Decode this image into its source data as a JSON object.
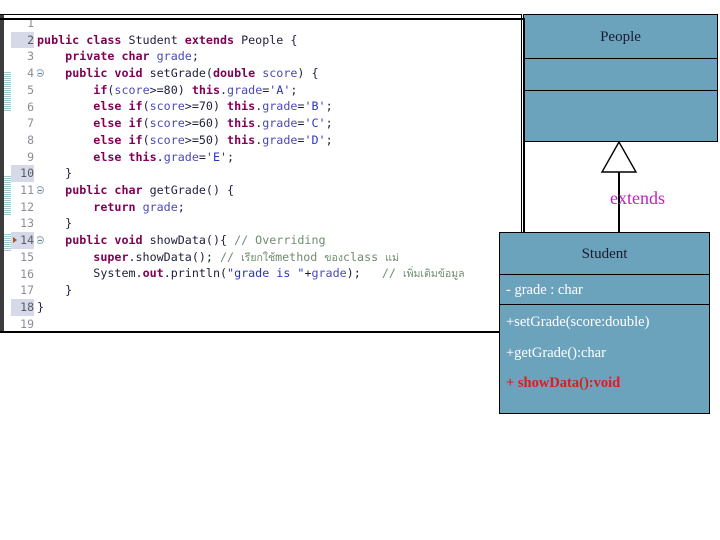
{
  "code_panel": {
    "name": "java-code-editor",
    "lines": [
      {
        "no": "1",
        "highlight": false,
        "fold": false,
        "override": false,
        "tokens": []
      },
      {
        "no": "2",
        "highlight": true,
        "fold": false,
        "override": false,
        "tokens": [
          {
            "t": "kw",
            "v": "public class "
          },
          {
            "t": "id",
            "v": "Student "
          },
          {
            "t": "kw",
            "v": "extends "
          },
          {
            "t": "id",
            "v": "People {"
          }
        ]
      },
      {
        "no": "3",
        "highlight": false,
        "fold": false,
        "override": false,
        "tokens": [
          {
            "t": "id",
            "v": "    "
          },
          {
            "t": "kw",
            "v": "private char "
          },
          {
            "t": "fld",
            "v": "grade"
          },
          {
            "t": "id",
            "v": ";"
          }
        ]
      },
      {
        "no": "4",
        "highlight": false,
        "fold": true,
        "override": false,
        "tokens": [
          {
            "t": "id",
            "v": "    "
          },
          {
            "t": "kw",
            "v": "public void "
          },
          {
            "t": "id",
            "v": "setGrade("
          },
          {
            "t": "kw",
            "v": "double "
          },
          {
            "t": "fld",
            "v": "score"
          },
          {
            "t": "id",
            "v": ") {"
          }
        ]
      },
      {
        "no": "5",
        "highlight": false,
        "fold": false,
        "override": false,
        "tokens": [
          {
            "t": "id",
            "v": "        "
          },
          {
            "t": "kw",
            "v": "if"
          },
          {
            "t": "id",
            "v": "("
          },
          {
            "t": "fld",
            "v": "score"
          },
          {
            "t": "id",
            "v": ">=80) "
          },
          {
            "t": "kw",
            "v": "this"
          },
          {
            "t": "id",
            "v": "."
          },
          {
            "t": "fld",
            "v": "grade"
          },
          {
            "t": "id",
            "v": "="
          },
          {
            "t": "str",
            "v": "'A'"
          },
          {
            "t": "id",
            "v": ";"
          }
        ]
      },
      {
        "no": "6",
        "highlight": false,
        "fold": false,
        "override": false,
        "tokens": [
          {
            "t": "id",
            "v": "        "
          },
          {
            "t": "kw",
            "v": "else if"
          },
          {
            "t": "id",
            "v": "("
          },
          {
            "t": "fld",
            "v": "score"
          },
          {
            "t": "id",
            "v": ">=70) "
          },
          {
            "t": "kw",
            "v": "this"
          },
          {
            "t": "id",
            "v": "."
          },
          {
            "t": "fld",
            "v": "grade"
          },
          {
            "t": "id",
            "v": "="
          },
          {
            "t": "str",
            "v": "'B'"
          },
          {
            "t": "id",
            "v": ";"
          }
        ]
      },
      {
        "no": "7",
        "highlight": false,
        "fold": false,
        "override": false,
        "tokens": [
          {
            "t": "id",
            "v": "        "
          },
          {
            "t": "kw",
            "v": "else if"
          },
          {
            "t": "id",
            "v": "("
          },
          {
            "t": "fld",
            "v": "score"
          },
          {
            "t": "id",
            "v": ">=60) "
          },
          {
            "t": "kw",
            "v": "this"
          },
          {
            "t": "id",
            "v": "."
          },
          {
            "t": "fld",
            "v": "grade"
          },
          {
            "t": "id",
            "v": "="
          },
          {
            "t": "str",
            "v": "'C'"
          },
          {
            "t": "id",
            "v": ";"
          }
        ]
      },
      {
        "no": "8",
        "highlight": false,
        "fold": false,
        "override": false,
        "tokens": [
          {
            "t": "id",
            "v": "        "
          },
          {
            "t": "kw",
            "v": "else if"
          },
          {
            "t": "id",
            "v": "("
          },
          {
            "t": "fld",
            "v": "score"
          },
          {
            "t": "id",
            "v": ">=50) "
          },
          {
            "t": "kw",
            "v": "this"
          },
          {
            "t": "id",
            "v": "."
          },
          {
            "t": "fld",
            "v": "grade"
          },
          {
            "t": "id",
            "v": "="
          },
          {
            "t": "str",
            "v": "'D'"
          },
          {
            "t": "id",
            "v": ";"
          }
        ]
      },
      {
        "no": "9",
        "highlight": false,
        "fold": false,
        "override": false,
        "tokens": [
          {
            "t": "id",
            "v": "        "
          },
          {
            "t": "kw",
            "v": "else this"
          },
          {
            "t": "id",
            "v": "."
          },
          {
            "t": "fld",
            "v": "grade"
          },
          {
            "t": "id",
            "v": "="
          },
          {
            "t": "str",
            "v": "'E'"
          },
          {
            "t": "id",
            "v": ";"
          }
        ]
      },
      {
        "no": "10",
        "highlight": true,
        "fold": false,
        "override": false,
        "tokens": [
          {
            "t": "id",
            "v": "    }"
          }
        ]
      },
      {
        "no": "11",
        "highlight": false,
        "fold": true,
        "override": false,
        "tokens": [
          {
            "t": "id",
            "v": "    "
          },
          {
            "t": "kw",
            "v": "public char "
          },
          {
            "t": "id",
            "v": "getGrade() {"
          }
        ]
      },
      {
        "no": "12",
        "highlight": false,
        "fold": false,
        "override": false,
        "tokens": [
          {
            "t": "id",
            "v": "        "
          },
          {
            "t": "kw",
            "v": "return "
          },
          {
            "t": "fld",
            "v": "grade"
          },
          {
            "t": "id",
            "v": ";"
          }
        ]
      },
      {
        "no": "13",
        "highlight": false,
        "fold": false,
        "override": false,
        "tokens": [
          {
            "t": "id",
            "v": "    }"
          }
        ]
      },
      {
        "no": "14",
        "highlight": true,
        "fold": true,
        "override": true,
        "tokens": [
          {
            "t": "id",
            "v": "    "
          },
          {
            "t": "kw",
            "v": "public void "
          },
          {
            "t": "id",
            "v": "showData(){ "
          },
          {
            "t": "cmt",
            "v": "// Overriding"
          }
        ]
      },
      {
        "no": "15",
        "highlight": false,
        "fold": false,
        "override": false,
        "tokens": [
          {
            "t": "id",
            "v": "        "
          },
          {
            "t": "kw",
            "v": "super"
          },
          {
            "t": "id",
            "v": ".showData(); "
          },
          {
            "t": "cmt",
            "v": "// "
          },
          {
            "t": "cmtth",
            "v": "เรียกใช้"
          },
          {
            "t": "cmt",
            "v": "method "
          },
          {
            "t": "cmtth",
            "v": "ของ"
          },
          {
            "t": "cmt",
            "v": "class "
          },
          {
            "t": "cmtth",
            "v": "แม่"
          }
        ]
      },
      {
        "no": "16",
        "highlight": false,
        "fold": false,
        "override": false,
        "tokens": [
          {
            "t": "id",
            "v": "        System."
          },
          {
            "t": "kw",
            "v": "out"
          },
          {
            "t": "id",
            "v": ".println("
          },
          {
            "t": "str",
            "v": "\"grade is \""
          },
          {
            "t": "id",
            "v": "+"
          },
          {
            "t": "fld",
            "v": "grade"
          },
          {
            "t": "id",
            "v": ");   "
          },
          {
            "t": "cmt",
            "v": "// "
          },
          {
            "t": "cmtth",
            "v": "เพิ่มเติมข้อมูล"
          }
        ]
      },
      {
        "no": "17",
        "highlight": false,
        "fold": false,
        "override": false,
        "tokens": [
          {
            "t": "id",
            "v": "    }"
          }
        ]
      },
      {
        "no": "18",
        "highlight": true,
        "fold": false,
        "override": false,
        "tokens": [
          {
            "t": "id",
            "v": "}"
          }
        ]
      },
      {
        "no": "19",
        "highlight": false,
        "fold": false,
        "override": false,
        "tokens": []
      }
    ]
  },
  "diagram": {
    "people_class": {
      "title": "People",
      "attributes": "",
      "operations": ""
    },
    "relationship": {
      "label": "extends",
      "type": "generalization",
      "label_color": "#c020c0"
    },
    "student_class": {
      "title": "Student",
      "attributes": [
        "- grade : char"
      ],
      "operations": [
        {
          "text": "+setGrade(score:double)",
          "highlight": false
        },
        {
          "text": "+getGrade():char",
          "highlight": false
        },
        {
          "text": "+ showData():void",
          "highlight": true
        }
      ]
    },
    "colors": {
      "box_fill": "#6ba3bd",
      "box_border": "#000000",
      "title_text": "#1a1a2e",
      "member_text": "#ffffff",
      "highlight_text": "#e01b1b"
    }
  }
}
